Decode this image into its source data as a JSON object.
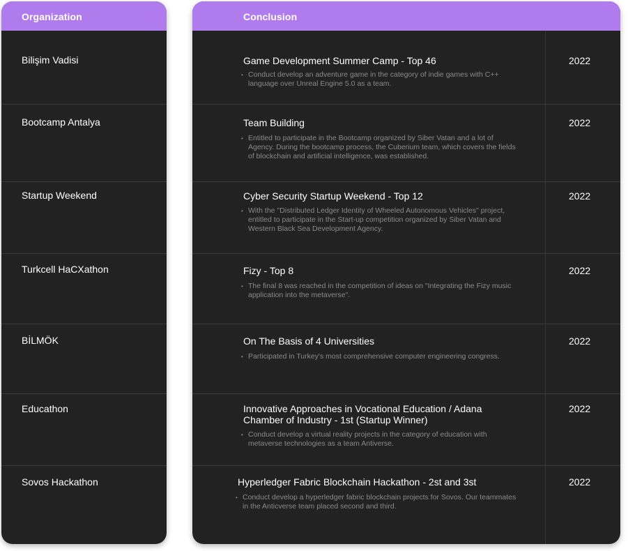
{
  "headers": {
    "organization": "Organization",
    "conclusion": "Conclusion"
  },
  "rows": [
    {
      "organization": "Bilişim Vadisi",
      "title": "Game Development Summer Camp - Top 46",
      "description": "Conduct develop an adventure game in the category of indie games with C++ language over Unreal Engine 5.0 as a team.",
      "year": "2022"
    },
    {
      "organization": "Bootcamp Antalya",
      "title": "Team Building",
      "description": "Entitled to participate in the Bootcamp organized by Siber Vatan and a lot of Agency. During the bootcamp process, the Cuberium team, which covers the fields of blockchain and artificial intelligence, was established.",
      "year": "2022"
    },
    {
      "organization": "Startup Weekend",
      "title": "Cyber Security Startup Weekend - Top 12",
      "description": "With the \"Distributed Ledger Identity of Wheeled Autonomous Vehicles\" project, entitled to participate in the Start-up competition organized by Siber Vatan and Western Black Sea Development Agency.",
      "year": "2022"
    },
    {
      "organization": "Turkcell HaCXathon",
      "title": "Fizy - Top 8",
      "description": "The final 8 was reached in the competition of ideas on \"Integrating the Fizy music application into the metaverse\".",
      "year": "2022"
    },
    {
      "organization": "BİLMÖK",
      "title": "On The Basis of 4 Universities",
      "description": "Participated in Turkey's most comprehensive computer engineering congress.",
      "year": "2022"
    },
    {
      "organization": "Educathon",
      "title": "Innovative Approaches in Vocational Education / Adana Chamber of Industry - 1st (Startup Winner)",
      "description": "Conduct develop a virtual reality projects in the category of education with metaverse technologies as a team Antiverse.",
      "year": "2022"
    },
    {
      "organization": "Sovos Hackathon",
      "title": "Hyperledger Fabric Blockchain Hackathon - 2st and 3st",
      "description": "Conduct develop a hyperledger fabric blockchain projects for Sovos. Our teammates in the Anticverse team placed second and third.",
      "year": "2022"
    }
  ],
  "colors": {
    "header": "#b07ced",
    "card": "#222222",
    "text": "#ffffff",
    "muted": "#8a8a8a"
  }
}
